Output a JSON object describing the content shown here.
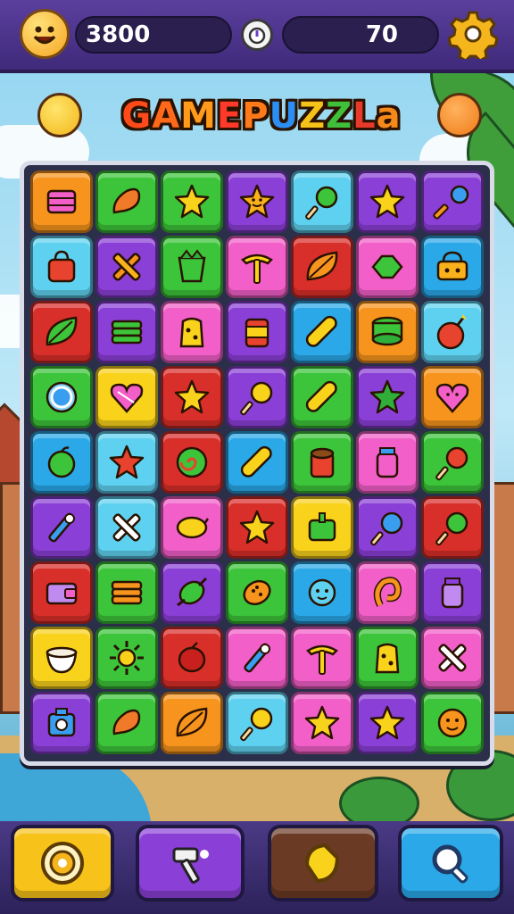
{
  "header": {
    "score": "3800",
    "moves": "70",
    "avatar_icon": "smiley-face-icon",
    "timer_icon": "stopwatch-icon",
    "settings_icon": "gear-icon"
  },
  "title": {
    "text": "GAMEPUZZLa",
    "letter_colors": [
      "#ff4a1a",
      "#ff6a1a",
      "#ff9a1a",
      "#ff3a2a",
      "#ff7a1a",
      "#2a8ef5",
      "#f5c21a",
      "#3fbf3a",
      "#e83a2a",
      "#f58a1a"
    ]
  },
  "colors": {
    "orange": "#f7941d",
    "green": "#3cc43a",
    "purple": "#8a3fd6",
    "blue": "#2aa8e8",
    "pink": "#f25fc8",
    "red": "#d92f2a",
    "yellow": "#f9d21c",
    "cyan": "#5fd1f0"
  },
  "board": {
    "rows": 9,
    "cols": 7,
    "tiles": [
      [
        {
          "c": "orange",
          "i": "box"
        },
        {
          "c": "green",
          "i": "drumstick"
        },
        {
          "c": "green",
          "i": "star"
        },
        {
          "c": "purple",
          "i": "star-face"
        },
        {
          "c": "cyan",
          "i": "lollipop"
        },
        {
          "c": "purple",
          "i": "star"
        },
        {
          "c": "purple",
          "i": "wand"
        }
      ],
      [
        {
          "c": "cyan",
          "i": "bag"
        },
        {
          "c": "purple",
          "i": "cross"
        },
        {
          "c": "green",
          "i": "pot"
        },
        {
          "c": "pink",
          "i": "pick"
        },
        {
          "c": "red",
          "i": "leaf"
        },
        {
          "c": "pink",
          "i": "gem"
        },
        {
          "c": "blue",
          "i": "basket"
        }
      ],
      [
        {
          "c": "red",
          "i": "leaf-green"
        },
        {
          "c": "purple",
          "i": "stack"
        },
        {
          "c": "pink",
          "i": "cheese"
        },
        {
          "c": "purple",
          "i": "can"
        },
        {
          "c": "blue",
          "i": "rolling-pin"
        },
        {
          "c": "orange",
          "i": "stack-green"
        },
        {
          "c": "cyan",
          "i": "bomb"
        }
      ],
      [
        {
          "c": "green",
          "i": "clock"
        },
        {
          "c": "yellow",
          "i": "heart"
        },
        {
          "c": "red",
          "i": "star"
        },
        {
          "c": "purple",
          "i": "lollipop-yellow"
        },
        {
          "c": "green",
          "i": "rolling-pin"
        },
        {
          "c": "purple",
          "i": "star-green"
        },
        {
          "c": "orange",
          "i": "heart-face"
        }
      ],
      [
        {
          "c": "blue",
          "i": "apple"
        },
        {
          "c": "cyan",
          "i": "star-red"
        },
        {
          "c": "red",
          "i": "swirl"
        },
        {
          "c": "blue",
          "i": "rolling-pin"
        },
        {
          "c": "green",
          "i": "cup"
        },
        {
          "c": "pink",
          "i": "jar"
        },
        {
          "c": "green",
          "i": "lollipop-red"
        }
      ],
      [
        {
          "c": "purple",
          "i": "wand-blue"
        },
        {
          "c": "cyan",
          "i": "cross-white"
        },
        {
          "c": "pink",
          "i": "lemon"
        },
        {
          "c": "red",
          "i": "star"
        },
        {
          "c": "yellow",
          "i": "box-green"
        },
        {
          "c": "purple",
          "i": "lollipop-blue"
        },
        {
          "c": "red",
          "i": "lollipop-green"
        }
      ],
      [
        {
          "c": "red",
          "i": "wallet"
        },
        {
          "c": "green",
          "i": "stack-orange"
        },
        {
          "c": "purple",
          "i": "lemon-green"
        },
        {
          "c": "green",
          "i": "cookie"
        },
        {
          "c": "blue",
          "i": "blob"
        },
        {
          "c": "pink",
          "i": "swirl-orange"
        },
        {
          "c": "purple",
          "i": "jar-purple"
        }
      ],
      [
        {
          "c": "yellow",
          "i": "bowl"
        },
        {
          "c": "green",
          "i": "sun"
        },
        {
          "c": "red",
          "i": "berry"
        },
        {
          "c": "pink",
          "i": "wand-blue"
        },
        {
          "c": "pink",
          "i": "pick"
        },
        {
          "c": "green",
          "i": "cheese"
        },
        {
          "c": "pink",
          "i": "cross-white"
        }
      ],
      [
        {
          "c": "purple",
          "i": "camera"
        },
        {
          "c": "green",
          "i": "drumstick"
        },
        {
          "c": "orange",
          "i": "leaf"
        },
        {
          "c": "cyan",
          "i": "lollipop-yellow"
        },
        {
          "c": "pink",
          "i": "star"
        },
        {
          "c": "purple",
          "i": "star"
        },
        {
          "c": "green",
          "i": "face-orange"
        }
      ]
    ]
  },
  "powerups": [
    {
      "name": "target-powerup-button",
      "icon": "target-icon",
      "color": "#f7c21a"
    },
    {
      "name": "hammer-powerup-button",
      "icon": "hammer-icon",
      "color": "#8a3fd6"
    },
    {
      "name": "shuffle-powerup-button",
      "icon": "lemon-slice-icon",
      "color": "#6b3a24"
    },
    {
      "name": "hint-powerup-button",
      "icon": "magnifier-icon",
      "color": "#2aa8e8"
    }
  ]
}
